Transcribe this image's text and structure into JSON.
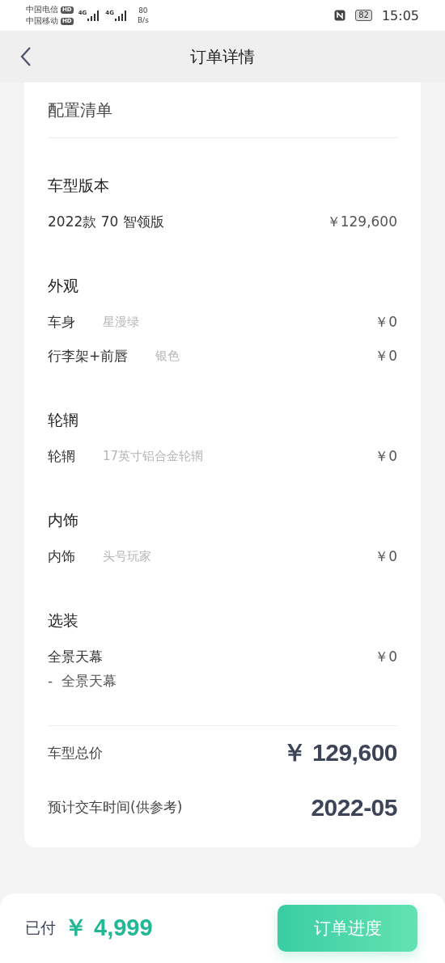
{
  "status_bar": {
    "carriers": [
      {
        "name": "中国电信",
        "badge": "HD"
      },
      {
        "name": "中国移动",
        "badge": "HD"
      }
    ],
    "networks": [
      "4G",
      "4G"
    ],
    "speed": [
      "80",
      "B/s"
    ],
    "battery": "82",
    "time": "15:05"
  },
  "nav": {
    "title": "订单详情"
  },
  "card": {
    "title": "配置清单",
    "sections": [
      {
        "title": "车型版本",
        "items": [
          {
            "name": "2022款 70 智领版",
            "price": "￥129,600"
          }
        ]
      },
      {
        "title": "外观",
        "items": [
          {
            "name": "车身",
            "option": "星漫绿",
            "price": "￥0"
          },
          {
            "name": "行李架+前唇",
            "option": "银色",
            "price": "￥0"
          }
        ]
      },
      {
        "title": "轮辋",
        "items": [
          {
            "name": "轮辋",
            "option": "17英寸铝合金轮辋",
            "price": "￥0"
          }
        ]
      },
      {
        "title": "内饰",
        "items": [
          {
            "name": "内饰",
            "option": "头号玩家",
            "price": "￥0"
          }
        ]
      },
      {
        "title": "选装",
        "items": [
          {
            "name": "全景天幕",
            "price": "￥0",
            "details": [
              "-  全景天幕"
            ]
          }
        ]
      }
    ],
    "summary": [
      {
        "label": "车型总价",
        "value": "￥ 129,600"
      },
      {
        "label": "预计交车时间(供参考)",
        "value": "2022-05"
      }
    ]
  },
  "bottom_bar": {
    "paid_label": "已付",
    "paid_amount": "￥ 4,999",
    "button": "订单进度"
  }
}
